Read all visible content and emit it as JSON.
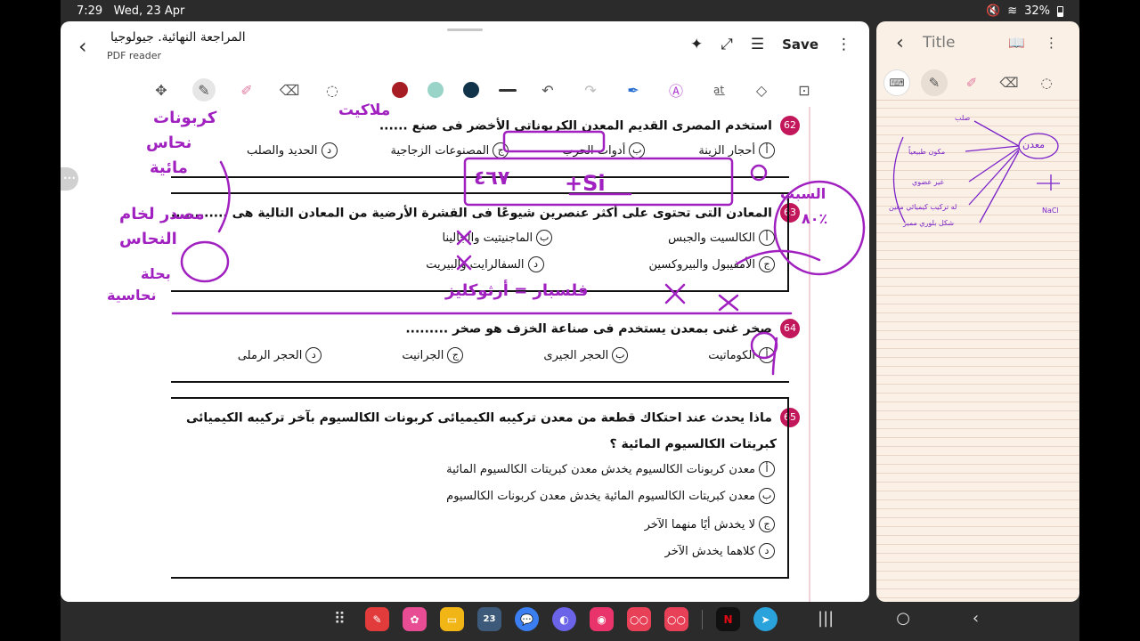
{
  "status": {
    "time": "7:29",
    "date": "Wed, 23 Apr",
    "battery": "32%"
  },
  "left_window": {
    "title": "المراجعة النهائية. جيولوجيا",
    "subtitle": "PDF reader",
    "save_label": "Save",
    "colors": {
      "red": "#a71d24",
      "teal": "#9ad4c8",
      "navy": "#12344a"
    }
  },
  "questions": [
    {
      "num": "62",
      "text": "استخدم المصرى القديم المعدن الكربوناتى الأخضر فى صنع ......",
      "options": [
        {
          "letter": "أ",
          "text": "أحجار الزينة"
        },
        {
          "letter": "ب",
          "text": "أدوات الحرب"
        },
        {
          "letter": "ج",
          "text": "المصنوعات الزجاجية"
        },
        {
          "letter": "د",
          "text": "الحديد والصلب"
        }
      ]
    },
    {
      "num": "63",
      "text": "المعادن التى تحتوى على أكثر عنصرين شيوعًا فى القشرة الأرضية من المعادن التالية هى ............",
      "options": [
        {
          "letter": "أ",
          "text": "الكالسيت والجبس"
        },
        {
          "letter": "ب",
          "text": "الماجنيتيت والجالينا"
        },
        {
          "letter": "ج",
          "text": "الأمفيبول والبيروكسين"
        },
        {
          "letter": "د",
          "text": "السفالرايت والبيريت"
        }
      ]
    },
    {
      "num": "64",
      "text": "صخر غنى بمعدن يستخدم فى صناعة الخزف هو صخر .........",
      "options": [
        {
          "letter": "أ",
          "text": "الكوماتيت"
        },
        {
          "letter": "ب",
          "text": "الحجر الجيرى"
        },
        {
          "letter": "ج",
          "text": "الجرانيت"
        },
        {
          "letter": "د",
          "text": "الحجر الرملى"
        }
      ]
    },
    {
      "num": "65",
      "text": "ماذا يحدث عند احتكاك قطعة من معدن تركيبه الكيميائى كربونات الكالسيوم بآخر تركيبه الكيميائى",
      "text2": "كبريتات الكالسيوم المائية ؟",
      "options": [
        {
          "letter": "أ",
          "text": "معدن كربونات الكالسيوم يخدش معدن كبريتات الكالسيوم المائية"
        },
        {
          "letter": "ب",
          "text": "معدن كبريتات الكالسيوم المائية يخدش معدن كربونات الكالسيوم"
        },
        {
          "letter": "ج",
          "text": "لا يخدش أيًا منهما الآخر"
        },
        {
          "letter": "د",
          "text": "كلاهما يخدش الآخر"
        }
      ]
    }
  ],
  "annotations": {
    "a1": "كربونات",
    "a2": "نحاس",
    "a3": "مائية",
    "a4": "مصدر لخام",
    "a5": "النحاس",
    "a6": "بحلة",
    "a7": "نحاسية",
    "a8": "ملاكيت",
    "a9": "فلسبار = أرثوكليز",
    "a10": "+Si",
    "a11": "٤٦٧",
    "a12": "السبب",
    "a13": "٨٠٪"
  },
  "right_window": {
    "title": "Title",
    "notes": {
      "n1": "صلب",
      "n2": "معدن",
      "n3": "مكون طبيعياً",
      "n4": "غير عضوي",
      "n5": "له تركيب كيميائي معين",
      "n6": "شكل بلوري مميز",
      "n7": "NaCl"
    }
  }
}
